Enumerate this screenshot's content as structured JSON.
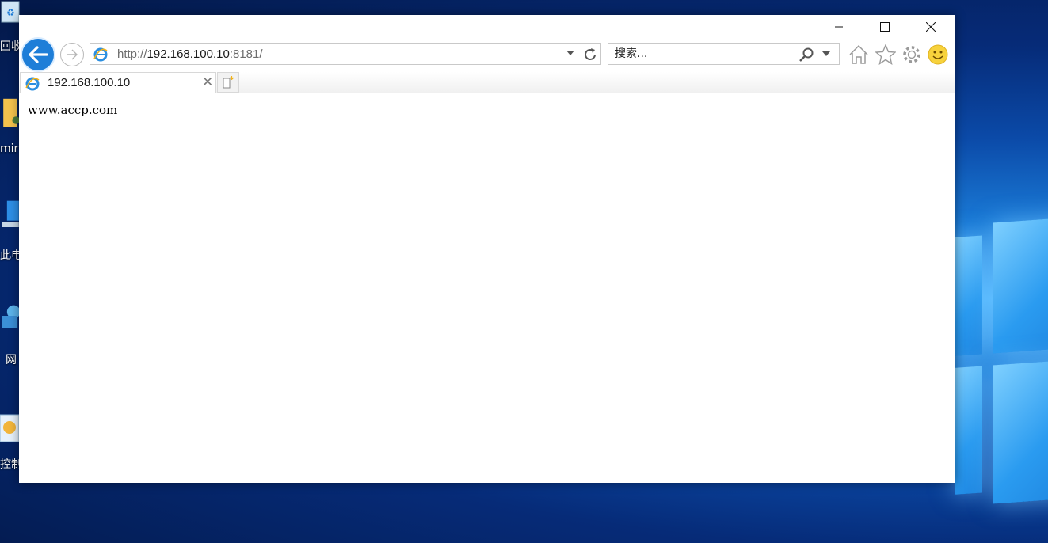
{
  "desktop": {
    "icons": [
      {
        "label": "回收",
        "icon": "recycle-bin-icon"
      },
      {
        "label": "mir",
        "icon": "folder-icon"
      },
      {
        "label": "此电",
        "icon": "this-pc-icon"
      },
      {
        "label": "网",
        "icon": "network-icon"
      },
      {
        "label": "控制",
        "icon": "control-panel-icon"
      }
    ]
  },
  "browser": {
    "window_controls": {
      "minimize": "minimize-icon",
      "maximize": "maximize-icon",
      "close": "close-icon"
    },
    "address": {
      "scheme": "http://",
      "host": "192.168.100.10",
      "rest": ":8181/"
    },
    "search": {
      "placeholder": "搜索..."
    },
    "tabs": [
      {
        "title": "192.168.100.10",
        "active": true
      }
    ]
  },
  "page": {
    "body_text": "www.accp.com"
  },
  "colors": {
    "accent": "#1e7ed8",
    "desktop_bg": "#062b78"
  }
}
